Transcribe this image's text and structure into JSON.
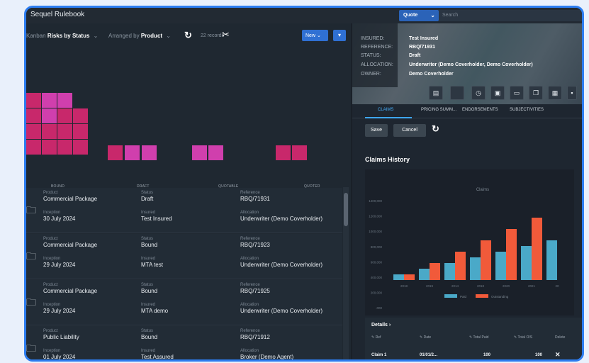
{
  "app": {
    "title": "Sequel Rulebook"
  },
  "top_search": {
    "scope": "Quote",
    "placeholder": "Search"
  },
  "toolbar": {
    "kanban_prefix": "Kanban",
    "kanban_value": "Risks by Status",
    "arranged_prefix": "Arranged by",
    "arranged_value": "Product",
    "records": "22 records",
    "new_label": "New"
  },
  "kanban": {
    "columns": [
      {
        "label": "BOUND",
        "count": 14
      },
      {
        "label": "DRAFT",
        "count": 3
      },
      {
        "label": "QUOTABLE",
        "count": 2
      },
      {
        "label": "QUOTED",
        "count": 2
      }
    ],
    "colors": {
      "primary": "#c8286b",
      "secondary": "#d03fad"
    }
  },
  "cards": [
    {
      "product_label": "Product",
      "product": "Commercial Package",
      "status_label": "Status",
      "status": "Draft",
      "reference_label": "Reference",
      "reference": "RBQ/71931",
      "inception_label": "Inception",
      "inception": "30 July 2024",
      "insured_label": "Insured",
      "insured": "Test Insured",
      "allocation_label": "Allocation",
      "allocation": "Underwriter (Demo Coverholder)"
    },
    {
      "product_label": "Product",
      "product": "Commercial Package",
      "status_label": "Status",
      "status": "Bound",
      "reference_label": "Reference",
      "reference": "RBQ/71923",
      "inception_label": "Inception",
      "inception": "29 July 2024",
      "insured_label": "Insured",
      "insured": "MTA test",
      "allocation_label": "Allocation",
      "allocation": "Underwriter (Demo Coverholder)"
    },
    {
      "product_label": "Product",
      "product": "Commercial Package",
      "status_label": "Status",
      "status": "Bound",
      "reference_label": "Reference",
      "reference": "RBQ/71925",
      "inception_label": "Inception",
      "inception": "29 July 2024",
      "insured_label": "Insured",
      "insured": "MTA demo",
      "allocation_label": "Allocation",
      "allocation": "Underwriter (Demo Coverholder)"
    },
    {
      "product_label": "Product",
      "product": "Public Liability",
      "status_label": "Status",
      "status": "Bound",
      "reference_label": "Reference",
      "reference": "RBQ/71912",
      "inception_label": "Inception",
      "inception": "01 July 2024",
      "insured_label": "Insured",
      "insured": "Test Assured",
      "allocation_label": "Allocation",
      "allocation": "Broker (Demo Agent)"
    }
  ],
  "detail": {
    "insured_label": "INSURED:",
    "insured": "Test Insured",
    "reference_label": "REFERENCE:",
    "reference": "RBQ/71931",
    "status_label": "STATUS:",
    "status": "Draft",
    "allocation_label": "ALLOCATION:",
    "allocation": "Underwriter (Demo Coverholder, Demo Coverholder)",
    "owner_label": "OWNER:",
    "owner": "Demo Coverholder"
  },
  "tabs": [
    "CLAIMS",
    "PRICING SUMM...",
    "ENDORSEMENTS",
    "SUBJECTIVITIES"
  ],
  "actions": {
    "save": "Save",
    "cancel": "Cancel"
  },
  "claims_title": "Claims History",
  "chart_data": {
    "type": "bar",
    "title": "Claims",
    "categories": [
      "2018",
      "2019",
      "2020",
      "2021",
      "2022",
      "2023",
      "2024"
    ],
    "category_labels": [
      "2018",
      "2019",
      "2014",
      "2018",
      "2020",
      "2021",
      "20"
    ],
    "series": [
      {
        "name": "Paid",
        "values": [
          100000,
          200000,
          300000,
          400000,
          500000,
          600000,
          700000
        ],
        "color": "#4aa9c8"
      },
      {
        "name": "Outstanding",
        "values": [
          100000,
          300000,
          500000,
          700000,
          900000,
          1100000,
          0
        ],
        "color": "#f15a3a"
      }
    ],
    "ylim": [
      0,
      1400000
    ],
    "yticks": [
      "1400,000",
      "1200,000",
      "1000,000",
      "800,000",
      "600,000",
      "400,000",
      "200,000",
      ".000"
    ],
    "grid": false,
    "legend": "bottom"
  },
  "details_table": {
    "title": "Details",
    "headers": [
      "Ref",
      "Date",
      "Total Paid",
      "Total O/S",
      "Delete"
    ],
    "row": {
      "ref": "Claim 1",
      "date": "01/01/2...",
      "paid": "100",
      "os": "100",
      "delete": "✕"
    }
  }
}
